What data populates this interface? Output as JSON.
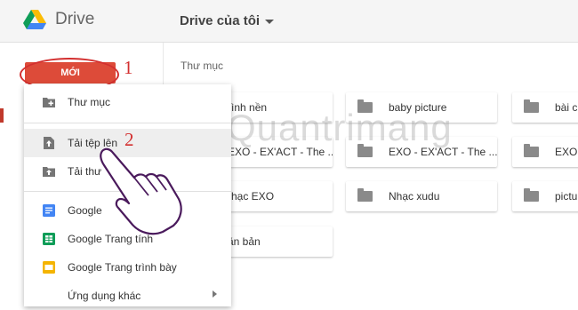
{
  "header": {
    "app_name": "Drive",
    "location": "Drive của tôi"
  },
  "new_button": {
    "label": "MỚI"
  },
  "steps": {
    "one": "1",
    "two": "2"
  },
  "section": {
    "title": "Thư mục"
  },
  "folders": [
    {
      "name": "ình nền"
    },
    {
      "name": "baby picture"
    },
    {
      "name": "bài ch"
    },
    {
      "name": "EXO - EX'ACT - The ..."
    },
    {
      "name": "EXO - EX'ACT - The ..."
    },
    {
      "name": "EXO -"
    },
    {
      "name": "hạc EXO"
    },
    {
      "name": "Nhạc xudu"
    },
    {
      "name": "pictur"
    },
    {
      "name": "ăn bản"
    }
  ],
  "menu": {
    "items": [
      {
        "label": "Thư mục",
        "icon": "new-folder-icon"
      },
      {
        "label": "Tải tệp lên",
        "icon": "file-upload-icon"
      },
      {
        "label": "Tải thư",
        "icon": "folder-upload-icon"
      },
      {
        "label": "Google",
        "icon": "google-docs-icon"
      },
      {
        "label": "Google Trang tính",
        "icon": "google-sheets-icon"
      },
      {
        "label": "Google Trang trình bày",
        "icon": "google-slides-icon"
      },
      {
        "label": "Ứng dụng khác",
        "icon": "more-apps-icon"
      }
    ]
  },
  "watermark": {
    "text": "Quantrimang"
  },
  "colors": {
    "new_button": "#dd4b39",
    "annotation_red": "#d32f2f",
    "docs_blue": "#4285f4",
    "sheets_green": "#0f9d58",
    "slides_yellow": "#f4b400",
    "hand_purple": "#4a1a5c"
  }
}
